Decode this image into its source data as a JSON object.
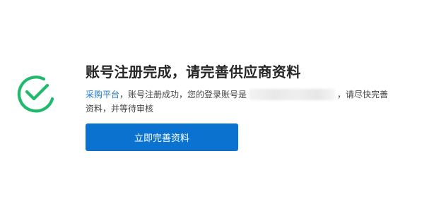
{
  "icon": {
    "name": "check-circle-icon",
    "color": "#1fba6b"
  },
  "heading": "账号注册完成，请完善供应商资料",
  "message": {
    "platform_link": "采购平台",
    "text_before_account": "，账号注册成功，您的登录账号是",
    "account_masked": "",
    "text_after_account": "，请尽快完善资料，并等待审核"
  },
  "primary_button": {
    "label": "立即完善资料",
    "color": "#0b73cf"
  }
}
